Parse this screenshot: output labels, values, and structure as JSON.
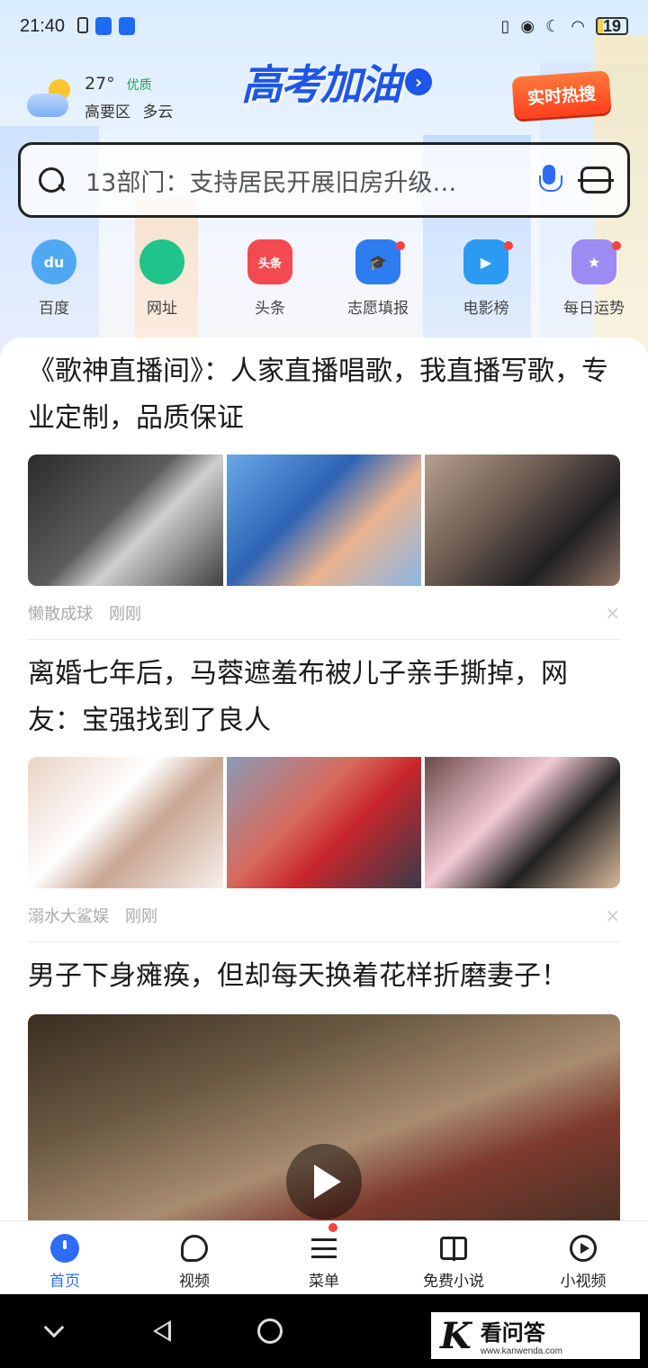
{
  "status": {
    "time": "21:40",
    "battery": "19"
  },
  "weather": {
    "temperature": "27°",
    "air_quality": "优质",
    "location": "高要区",
    "condition": "多云"
  },
  "banner": {
    "logo_text": "高考加油",
    "logo_arrow": "›",
    "hot_search": "实时热搜"
  },
  "search": {
    "query": "13部门：支持居民开展旧房升级…"
  },
  "quick_links": [
    {
      "label": "百度",
      "glyph": "du",
      "badge": false
    },
    {
      "label": "网址",
      "glyph": "",
      "badge": false
    },
    {
      "label": "头条",
      "glyph": "头条",
      "badge": false
    },
    {
      "label": "志愿填报",
      "glyph": "🎓",
      "badge": true
    },
    {
      "label": "电影榜",
      "glyph": "▶",
      "badge": true
    },
    {
      "label": "每日运势",
      "glyph": "★",
      "badge": true
    }
  ],
  "feed": [
    {
      "title": "《歌神直播间》：人家直播唱歌，我直播写歌，专业定制，品质保证",
      "source": "懒散成球",
      "time": "刚刚",
      "close": "×"
    },
    {
      "title": "离婚七年后，马蓉遮羞布被儿子亲手撕掉，网友：宝强找到了良人",
      "source": "溺水大鲨娱",
      "time": "刚刚",
      "close": "×"
    },
    {
      "title": "男子下身瘫痪，但却每天换着花样折磨妻子！"
    }
  ],
  "bottom_nav": [
    {
      "label": "首页",
      "icon": "home-icon",
      "active": true
    },
    {
      "label": "视频",
      "icon": "video-icon",
      "active": false
    },
    {
      "label": "菜单",
      "icon": "menu-icon",
      "active": false,
      "badge": true
    },
    {
      "label": "免费小说",
      "icon": "book-icon",
      "active": false
    },
    {
      "label": "小视频",
      "icon": "mini-video-icon",
      "active": false
    }
  ],
  "watermark": {
    "logo": "K",
    "name": "看问答",
    "url": "www.kanwenda.com"
  },
  "colors": {
    "accent": "#2e6bf6",
    "badge": "#f5453b",
    "air_quality": "#19a05c"
  }
}
